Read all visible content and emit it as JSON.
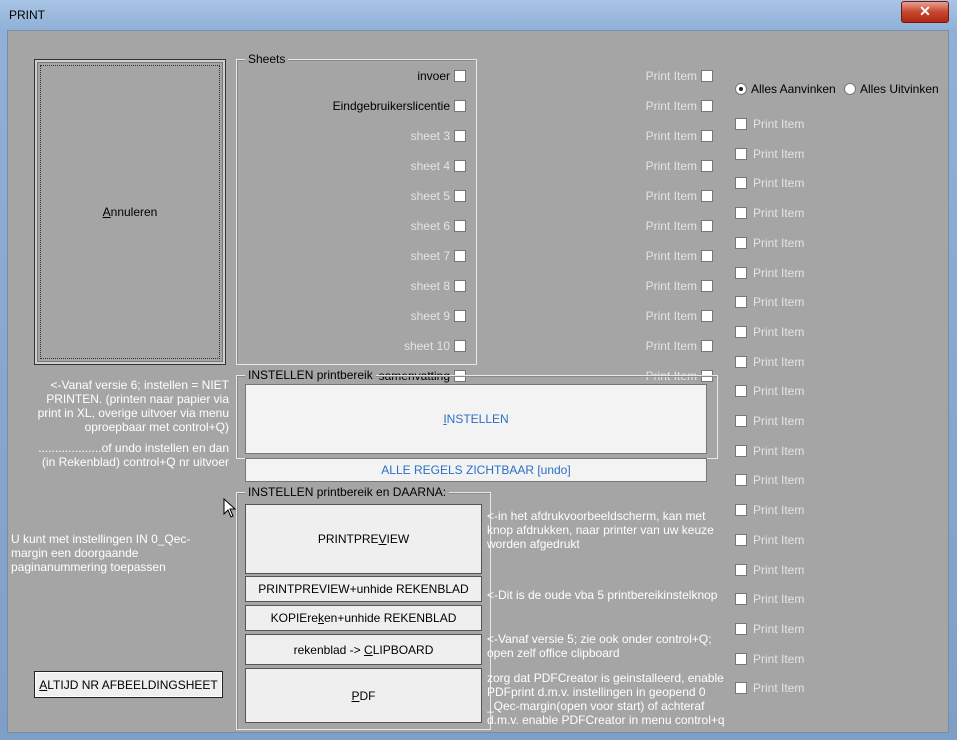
{
  "window": {
    "title": "PRINT",
    "close_icon": "close-icon"
  },
  "cancel_button": {
    "label_before": "",
    "label_u": "A",
    "label_after": "nnuleren"
  },
  "sheets": {
    "title": "Sheets",
    "items": [
      {
        "label": "invoer",
        "enabled": true
      },
      {
        "label": "Eindgebruikerslicentie",
        "enabled": true
      },
      {
        "label": "sheet 3",
        "enabled": false
      },
      {
        "label": "sheet 4",
        "enabled": false
      },
      {
        "label": "sheet 5",
        "enabled": false
      },
      {
        "label": "sheet 6",
        "enabled": false
      },
      {
        "label": "sheet 7",
        "enabled": false
      },
      {
        "label": "sheet 8",
        "enabled": false
      },
      {
        "label": "sheet 9",
        "enabled": false
      },
      {
        "label": "sheet 10",
        "enabled": false
      },
      {
        "label": "samenvatting",
        "enabled": true
      }
    ]
  },
  "print_items_col1": [
    "Print Item",
    "Print Item",
    "Print Item",
    "Print Item",
    "Print Item",
    "Print Item",
    "Print Item",
    "Print Item",
    "Print Item",
    "Print Item",
    "Print Item"
  ],
  "radio": {
    "check_all": "Alles Aanvinken",
    "uncheck_all": "Alles Uitvinken"
  },
  "print_items_col2": [
    "Print Item",
    "Print Item",
    "Print Item",
    "Print Item",
    "Print Item",
    "Print Item",
    "Print Item",
    "Print Item",
    "Print Item",
    "Print Item",
    "Print Item",
    "Print Item",
    "Print Item",
    "Print Item",
    "Print Item",
    "Print Item",
    "Print Item",
    "Print Item",
    "Print Item",
    "Print Item"
  ],
  "instellen_frame": {
    "title": "INSTELLEN printbereik",
    "instellen_u": "I",
    "instellen_rest": "NSTELLEN",
    "alle_regels": "ALLE REGELS ZICHTBAAR [undo]"
  },
  "daarna_frame": {
    "title": "INSTELLEN printbereik en DAARNA:",
    "printpreview_before": "PRINTPRE",
    "printpreview_u": "V",
    "printpreview_after": "IEW",
    "printpreview_unhide": "PRINTPREVIEW+unhide REKENBLAD",
    "kopie_before": "KOPIEre",
    "kopie_u": "k",
    "kopie_after": "en+unhide REKENBLAD",
    "clipboard_before": "rekenblad -> ",
    "clipboard_u": "C",
    "clipboard_after": "LIPBOARD",
    "pdf_u": "P",
    "pdf_after": "DF"
  },
  "notes": {
    "versie6": "<-Vanaf versie 6; instellen = NIET PRINTEN. (printen naar papier via print in XL, overige uitvoer via menu oproepbaar met control+Q)",
    "undo": "...................of undo instellen en dan (in Rekenblad) control+Q nr uitvoer",
    "paginanummering": "U kunt met instellingen IN 0_Qec-margin een doorgaande paginanummering toepassen",
    "afdrukvoorbeeld": "<-in het afdrukvoorbeeldscherm, kan met knop afdrukken, naar printer van uw keuze worden afgedrukt",
    "oude_vba": "<-Dit is de oude vba 5 printbereikinstelknop",
    "versie5": "<-Vanaf versie 5; zie ook onder control+Q; open zelf office clipboard",
    "pdfcreator": "zorg dat PDFCreator is geinstalleerd, enable PDFprint d.m.v. instellingen in geopend 0 _Qec-margin(open voor start) of achteraf d.m.v. enable PDFCreator in menu control+q"
  },
  "altijd_button": {
    "label_u": "A",
    "label_rest": "LTIJD NR AFBEELDINGSHEET"
  }
}
